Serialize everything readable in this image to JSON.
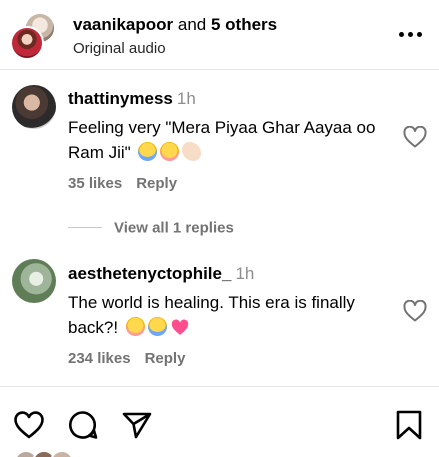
{
  "header": {
    "username": "vaanikapoor",
    "joiner": " and ",
    "others": "5 others",
    "subtitle": "Original audio"
  },
  "comments": [
    {
      "username": "thattinymess",
      "time": "1h",
      "text": "Feeling very \"Mera Piyaa Ghar Aayaa oo Ram Jii\"",
      "emojis": [
        "crying-face",
        "pleading-face",
        "pinched-fingers"
      ],
      "likes": "35 likes",
      "reply": "Reply"
    },
    {
      "username": "aesthetenyctophile_",
      "time": "1h",
      "text": "The world is healing. This era is finally back?!",
      "emojis": [
        "pleading-face",
        "crying-face",
        "sparkling-heart"
      ],
      "likes": "234 likes",
      "reply": "Reply"
    }
  ],
  "view_replies": "View all 1 replies",
  "colors": {
    "text": "#000000",
    "secondary": "#737373",
    "divider": "#e6e6e6",
    "heart_pink": "#ff4d8d"
  },
  "icons": [
    "more-icon",
    "heart-icon",
    "comment-icon",
    "share-icon",
    "bookmark-icon"
  ]
}
